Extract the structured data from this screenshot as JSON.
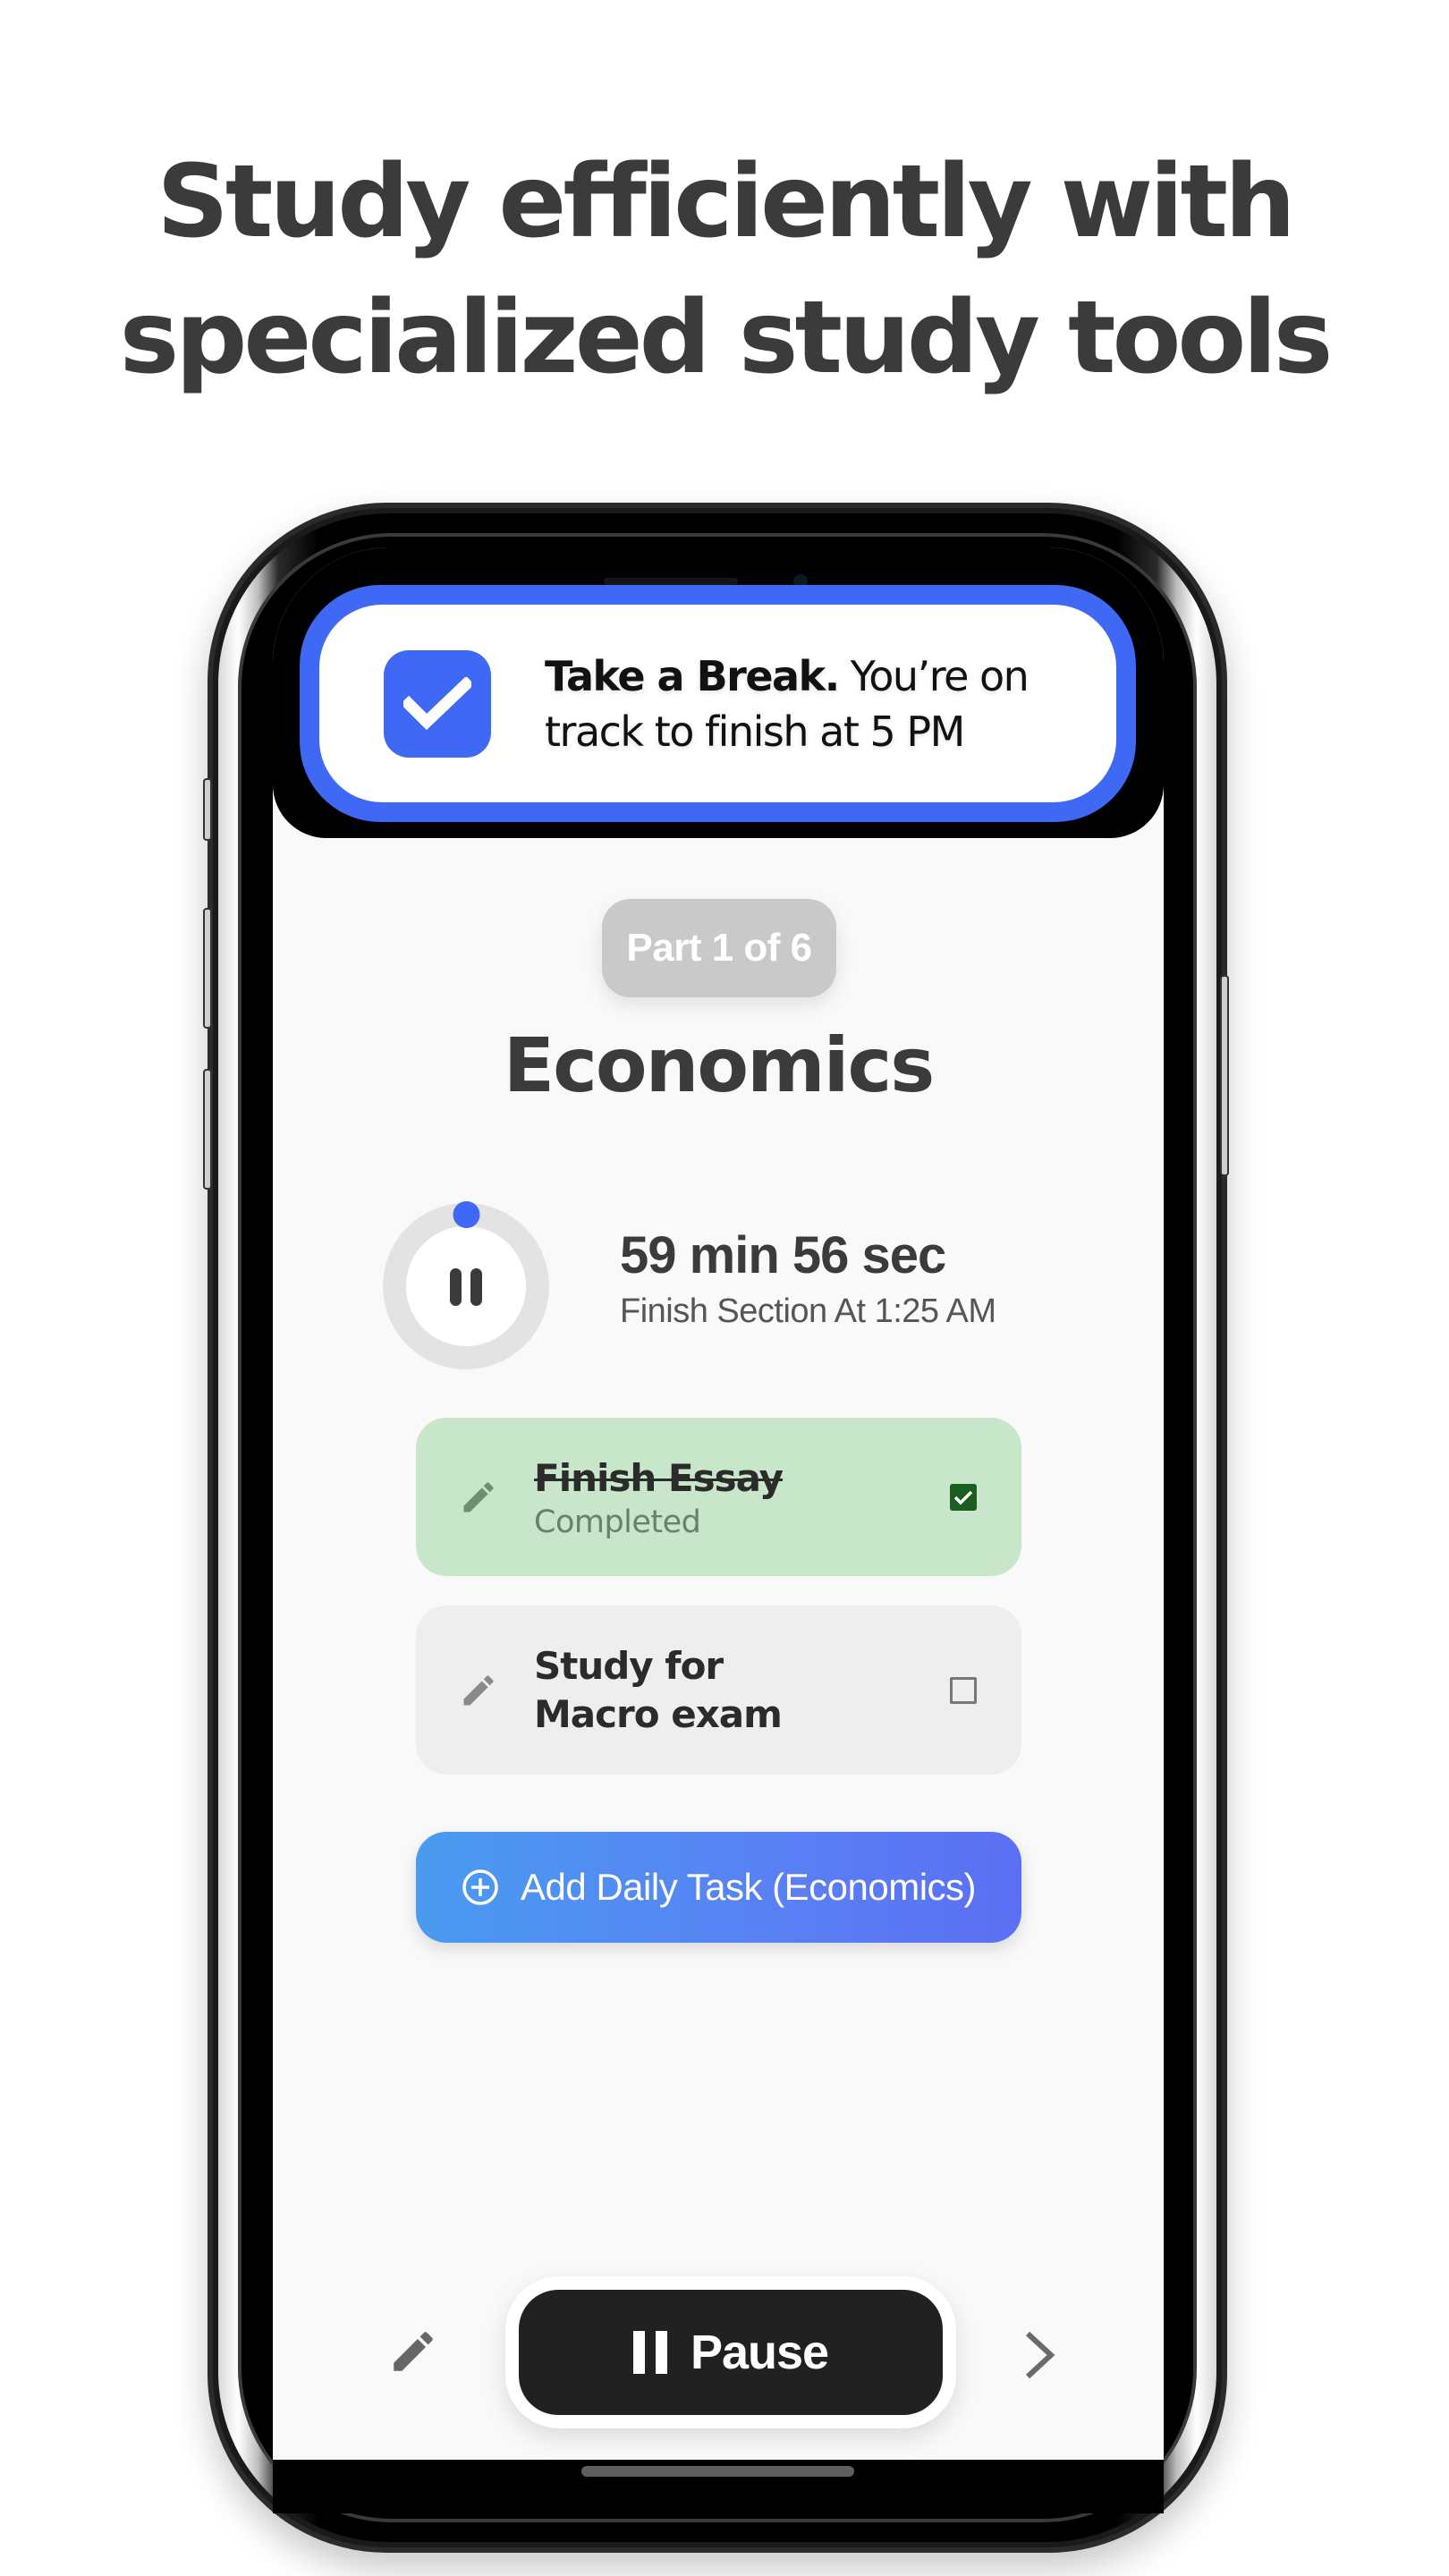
{
  "headline": {
    "line1_highlight": "Study efficiently",
    "line1_rest": " with",
    "line2_rest": "specialized ",
    "line2_highlight": "study tools"
  },
  "colors": {
    "accent_blue": "#3f68f5",
    "completed_green_bg": "#c8e6c9",
    "completed_check": "#1b5e20",
    "pause_button_bg": "#212121"
  },
  "notification": {
    "icon": "check-square-icon",
    "bold_text": "Take a Break.",
    "text": " You’re on track to finish at 5 PM"
  },
  "session": {
    "part_label": "Part 1 of 6",
    "subject": "Economics",
    "timer": {
      "remaining": "59 min 56 sec",
      "finish_label": "Finish Section At 1:25 AM",
      "progress_fraction": 0.001,
      "control_icon": "pause-icon"
    }
  },
  "tasks": [
    {
      "title": "Finish Essay",
      "status": "Completed",
      "checked": true,
      "icon": "pencil-icon"
    },
    {
      "title": "Study for Macro exam",
      "status": "",
      "checked": false,
      "icon": "pencil-icon"
    }
  ],
  "add_task": {
    "label": "Add Daily Task (Economics)",
    "icon": "plus-circle-icon"
  },
  "bottom_bar": {
    "edit_icon": "pencil-icon",
    "pause_label": "Pause",
    "pause_icon": "pause-icon",
    "next_icon": "chevron-right-icon"
  }
}
